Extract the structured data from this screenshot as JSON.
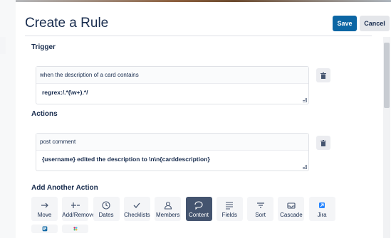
{
  "modal": {
    "title": "Create a Rule",
    "save_label": "Save",
    "cancel_label": "Cancel"
  },
  "trigger": {
    "section_label": "Trigger",
    "head_text": "when the description of a card contains",
    "value": "regrex:/.*(\\w+).*/"
  },
  "actions": {
    "section_label": "Actions",
    "head_text": "post comment",
    "value": "{username} edited the description to \\n\\n{carddescription}"
  },
  "add_another": {
    "section_label": "Add Another Action",
    "items": [
      {
        "label": "Move",
        "icon": "arrow-right-icon"
      },
      {
        "label": "Add/Remove",
        "icon": "plus-minus-icon"
      },
      {
        "label": "Dates",
        "icon": "clock-icon"
      },
      {
        "label": "Checklists",
        "icon": "check-icon"
      },
      {
        "label": "Members",
        "icon": "person-icon"
      },
      {
        "label": "Content",
        "icon": "comment-icon",
        "selected": true
      },
      {
        "label": "Fields",
        "icon": "lines-icon"
      },
      {
        "label": "Sort",
        "icon": "sort-icon"
      },
      {
        "label": "Cascade",
        "icon": "inbox-icon"
      },
      {
        "label": "Jira",
        "icon": "jira-icon"
      }
    ],
    "extra_icons": [
      "trello-icon",
      "slack-icon"
    ]
  },
  "colors": {
    "primary": "#0c66a4",
    "selected_tile": "#44546f",
    "tile_bg": "#f4f5f7"
  }
}
